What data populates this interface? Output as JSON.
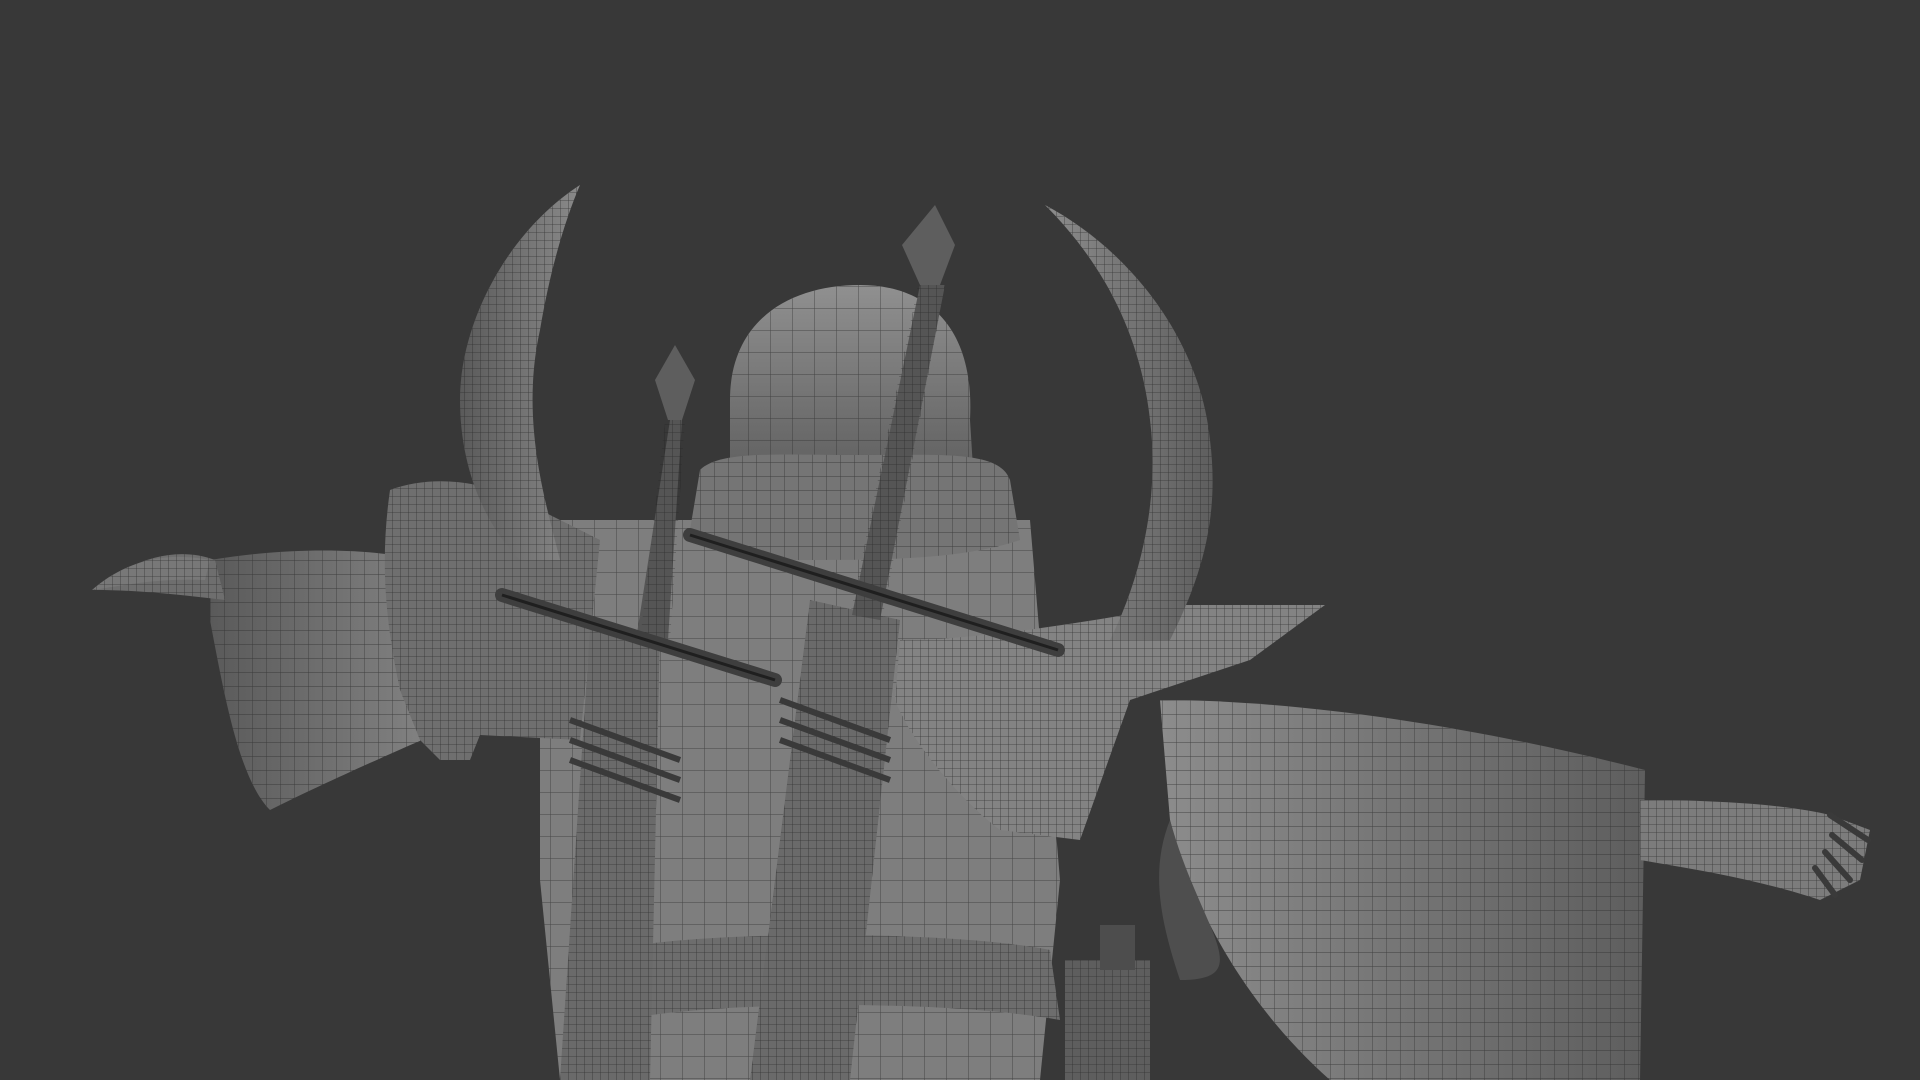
{
  "viewport": {
    "background_color": "#383838",
    "model_fill_color": "#7a7a7a",
    "model_shade_color": "#5c5c5c",
    "model_highlight_color": "#8e8e8e",
    "wire_color": "#2a2a2a",
    "display_mode": "wireframe-on-shaded"
  },
  "scene": {
    "subject": "character-model",
    "pose": "t-pose-back-view",
    "parts": [
      "hood",
      "collar",
      "left-horn",
      "right-horn",
      "left-pauldron",
      "right-pauldron",
      "left-sleeve",
      "right-sleeve",
      "left-hand",
      "right-hand",
      "torso",
      "belt",
      "left-sword",
      "right-sword",
      "left-scabbard",
      "right-scabbard",
      "pouch"
    ]
  }
}
